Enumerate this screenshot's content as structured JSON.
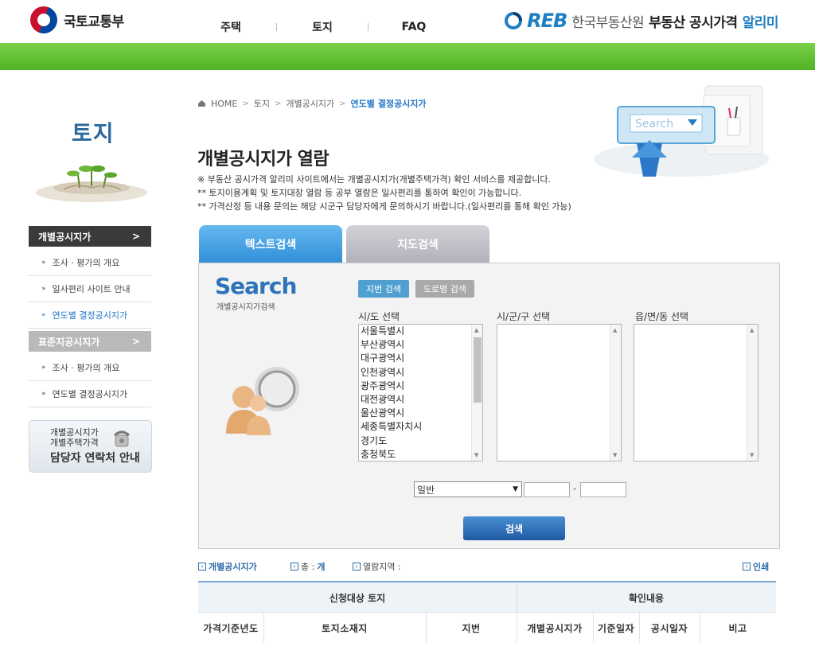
{
  "header": {
    "ministry": "국토교통부",
    "nav": [
      "주택",
      "토지",
      "FAQ"
    ],
    "reb_mark": "REB",
    "reb_org": "한국부동산원",
    "service_name": "부동산 공시가격",
    "service_accent": "알리미"
  },
  "sidebar": {
    "title": "토지",
    "groups": [
      {
        "label": "개별공시지가",
        "arrow": ">",
        "items": [
          {
            "label": "조사 · 평가의 개요",
            "bullet": "»"
          },
          {
            "label": "일사편리 사이트 안내",
            "bullet": "»"
          },
          {
            "label": "연도별 결정공시지가",
            "bullet": "»"
          }
        ]
      },
      {
        "label": "표준지공시지가",
        "arrow": ">",
        "items": [
          {
            "label": "조사 · 평가의 개요",
            "bullet": "»"
          },
          {
            "label": "연도별 결정공시지가",
            "bullet": "»"
          }
        ]
      }
    ],
    "contact": {
      "line1": "개별공시지가",
      "line2": "개별주택가격",
      "line3": "담당자 연락처 안내"
    }
  },
  "breadcrumb": {
    "home": "HOME",
    "items": [
      "토지",
      "개별공시지가"
    ],
    "current": "연도별 결정공시지가"
  },
  "main": {
    "title": "개별공시지가 열람",
    "notes": [
      "※ 부동산 공시가격 알리미 사이트에서는 개별공시지가(개별주택가격) 확인 서비스를 제공합니다.",
      "** 토지이용계획 및 토지대장 열람 등 공부 열람은 일사편리를 통하여 확인이 가능합니다.",
      "** 가격산정 등 내용 문의는 해당 시군구 담당자에게 문의하시기 바랍니다.(일사편리를 통해 확인 가능)"
    ],
    "tabs": [
      "텍스트검색",
      "지도검색"
    ],
    "search_logo": "Search",
    "search_logo_sub": "개별공시지가검색",
    "search_types": [
      "지번 검색",
      "도로명 검색"
    ],
    "columns": [
      "시/도 선택",
      "시/군/구 선택",
      "읍/면/동 선택"
    ],
    "sido_options": [
      "서울특별시",
      "부산광역시",
      "대구광역시",
      "인천광역시",
      "광주광역시",
      "대전광역시",
      "울산광역시",
      "세종특별자치시",
      "경기도",
      "충청북도"
    ],
    "lot_type_selected": "일반",
    "dash": "-",
    "search_button": "검색"
  },
  "result_bar": {
    "price": "개별공시지가",
    "total_label": "총 :",
    "total_unit": "개",
    "region_label": "열람지역 :",
    "print": "인쇄"
  },
  "result_table": {
    "group_headers": [
      "신청대상 토지",
      "확인내용"
    ],
    "columns": [
      "가격기준년도",
      "토지소재지",
      "지번",
      "개별공시지가",
      "기준일자",
      "공시일자",
      "비고"
    ]
  }
}
